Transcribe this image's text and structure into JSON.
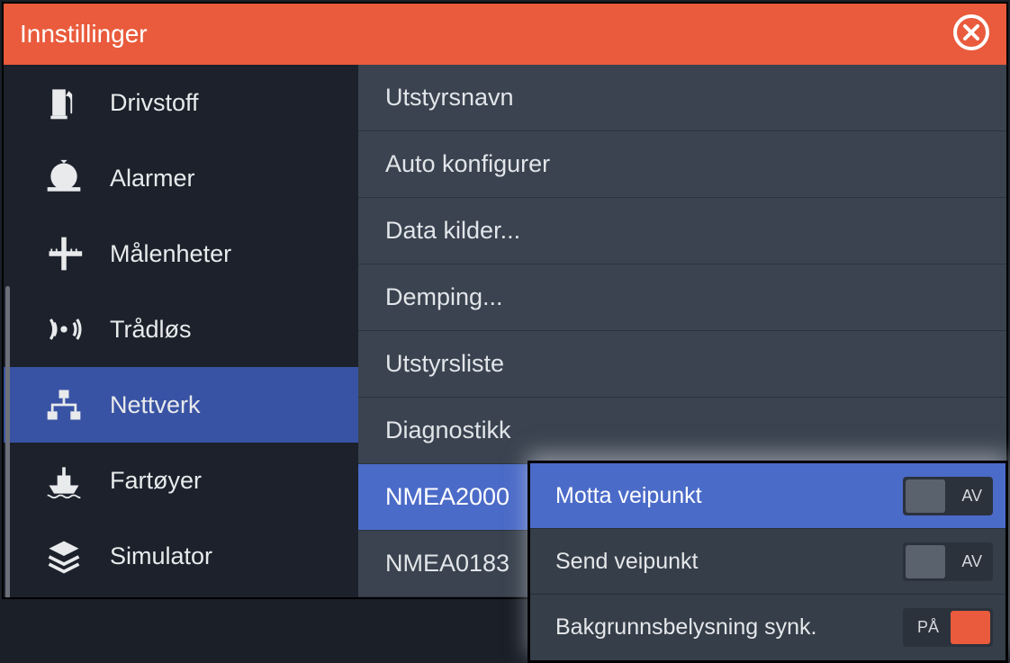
{
  "titlebar": {
    "title": "Innstillinger"
  },
  "sidebar": {
    "items": [
      {
        "id": "fuel",
        "label": "Drivstoff",
        "icon": "fuel-pump-icon",
        "selected": false
      },
      {
        "id": "alarms",
        "label": "Alarmer",
        "icon": "alarm-bell-icon",
        "selected": false
      },
      {
        "id": "units",
        "label": "Målenheter",
        "icon": "ruler-icon",
        "selected": false
      },
      {
        "id": "wireless",
        "label": "Trådløs",
        "icon": "wireless-icon",
        "selected": false
      },
      {
        "id": "network",
        "label": "Nettverk",
        "icon": "network-icon",
        "selected": true
      },
      {
        "id": "vessels",
        "label": "Fartøyer",
        "icon": "ship-icon",
        "selected": false
      },
      {
        "id": "simulator",
        "label": "Simulator",
        "icon": "layers-icon",
        "selected": false
      }
    ]
  },
  "main": {
    "items": [
      {
        "id": "device-name",
        "label": "Utstyrsnavn",
        "selected": false
      },
      {
        "id": "auto-config",
        "label": "Auto konfigurer",
        "selected": false
      },
      {
        "id": "data-sources",
        "label": "Data kilder...",
        "selected": false
      },
      {
        "id": "damping",
        "label": "Demping...",
        "selected": false
      },
      {
        "id": "device-list",
        "label": "Utstyrsliste",
        "selected": false
      },
      {
        "id": "diagnostics",
        "label": "Diagnostikk",
        "selected": false
      },
      {
        "id": "nmea2000",
        "label": "NMEA2000",
        "selected": true
      },
      {
        "id": "nmea0183",
        "label": "NMEA0183",
        "selected": false
      }
    ]
  },
  "submenu": {
    "items": [
      {
        "id": "receive-waypoint",
        "label": "Motta veipunkt",
        "state": "off",
        "state_label": "AV",
        "selected": true
      },
      {
        "id": "send-waypoint",
        "label": "Send veipunkt",
        "state": "off",
        "state_label": "AV",
        "selected": false
      },
      {
        "id": "backlight-sync",
        "label": "Bakgrunnsbelysning synk.",
        "state": "on",
        "state_label": "PÅ",
        "selected": false
      }
    ]
  }
}
